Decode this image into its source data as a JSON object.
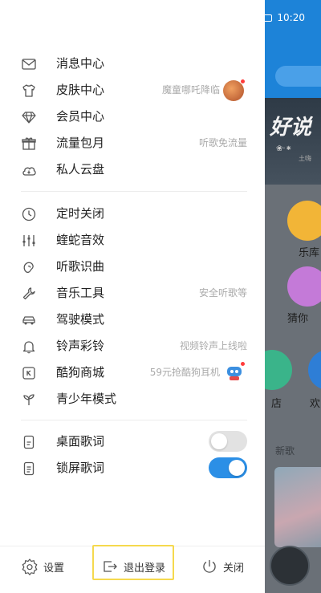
{
  "status_bar": {
    "time": "10:20"
  },
  "background": {
    "banner_title": "好说",
    "banner_sub": "土嗨",
    "tiles": [
      {
        "label": "乐库",
        "color": "#f2b537"
      },
      {
        "label": "猜你",
        "color": "#c47ad8"
      }
    ],
    "second_row": [
      {
        "label": "店",
        "color": "#3ab48a"
      },
      {
        "label": "欢",
        "color": "#2e7ed6"
      }
    ],
    "section_label": "新歌"
  },
  "menu_group_1": [
    {
      "icon": "mail-icon",
      "label": "消息中心",
      "hint": ""
    },
    {
      "icon": "tshirt-icon",
      "label": "皮肤中心",
      "hint": "魔童哪吒降临"
    },
    {
      "icon": "diamond-icon",
      "label": "会员中心",
      "hint": ""
    },
    {
      "icon": "gift-icon",
      "label": "流量包月",
      "hint": "听歌免流量"
    },
    {
      "icon": "cloud-icon",
      "label": "私人云盘",
      "hint": ""
    }
  ],
  "menu_group_2": [
    {
      "icon": "clock-icon",
      "label": "定时关闭",
      "hint": ""
    },
    {
      "icon": "equalizer-icon",
      "label": "蝰蛇音效",
      "hint": ""
    },
    {
      "icon": "recognize-icon",
      "label": "听歌识曲",
      "hint": ""
    },
    {
      "icon": "wrench-icon",
      "label": "音乐工具",
      "hint": "安全听歌等"
    },
    {
      "icon": "car-icon",
      "label": "驾驶模式",
      "hint": ""
    },
    {
      "icon": "bell-icon",
      "label": "铃声彩铃",
      "hint": "视频铃声上线啦"
    },
    {
      "icon": "store-icon",
      "label": "酷狗商城",
      "hint": "59元抢酷狗耳机"
    },
    {
      "icon": "sprout-icon",
      "label": "青少年模式",
      "hint": ""
    }
  ],
  "menu_group_3": [
    {
      "icon": "phone-lyrics-icon",
      "label": "桌面歌词",
      "toggle": false
    },
    {
      "icon": "lockscreen-lyrics-icon",
      "label": "锁屏歌词",
      "toggle": true
    }
  ],
  "bottom_bar": {
    "settings": "设置",
    "logout": "退出登录",
    "close": "关闭"
  },
  "colors": {
    "accent": "#2b8fe6",
    "badge": "#ff3b3b",
    "highlight_frame": "#f5d94e"
  }
}
